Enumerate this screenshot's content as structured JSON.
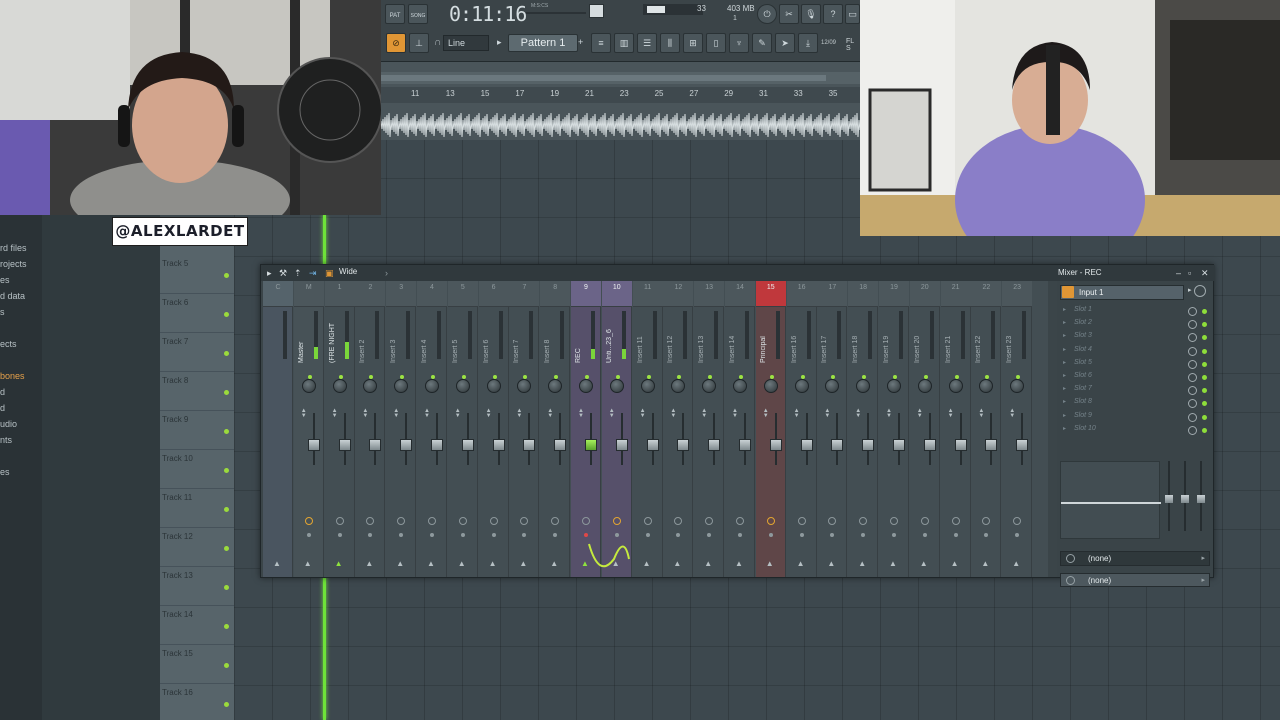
{
  "overlay": {
    "handle": "@ALEXLARDET"
  },
  "toolbar": {
    "mode_pat": "PAT",
    "mode_song": "SONG",
    "time": "0:11:16",
    "time_unit": "M:S:CS",
    "cpu": "33",
    "memory": "403 MB",
    "memory_sub": "1",
    "snap": "Line",
    "pattern": "Pattern 1",
    "time_sig": "12/09",
    "fl_label": "FL S"
  },
  "timeline": {
    "ruler": [
      "11",
      "13",
      "15",
      "17",
      "19",
      "21",
      "23",
      "25",
      "27",
      "29",
      "31",
      "33",
      "35"
    ]
  },
  "browser": {
    "items": [
      {
        "label": "rd files",
        "highlight": false
      },
      {
        "label": "rojects",
        "highlight": false
      },
      {
        "label": "es",
        "highlight": false
      },
      {
        "label": "d data",
        "highlight": false
      },
      {
        "label": "s",
        "highlight": false
      },
      {
        "label": "ects",
        "highlight": false
      },
      {
        "label": "bones",
        "highlight": true
      },
      {
        "label": "d",
        "highlight": false
      },
      {
        "label": "d",
        "highlight": false
      },
      {
        "label": "udio",
        "highlight": false
      },
      {
        "label": "nts",
        "highlight": false
      },
      {
        "label": "es",
        "highlight": false
      }
    ]
  },
  "playlist": {
    "tracks": [
      "Track 5",
      "Track 6",
      "Track 7",
      "Track 8",
      "Track 9",
      "Track 10",
      "Track 11",
      "Track 12",
      "Track 13",
      "Track 14",
      "Track 15",
      "Track 16"
    ]
  },
  "mixer": {
    "title": "Mixer - REC",
    "preset": "Wide",
    "strips": [
      {
        "num": "C",
        "name": "",
        "kind": "current"
      },
      {
        "num": "M",
        "name": "Master",
        "kind": "master"
      },
      {
        "num": "1",
        "name": "(FRE NIGHT",
        "kind": "bright"
      },
      {
        "num": "2",
        "name": "Insert 2",
        "kind": "normal"
      },
      {
        "num": "3",
        "name": "Insert 3",
        "kind": "normal"
      },
      {
        "num": "4",
        "name": "Insert 4",
        "kind": "normal"
      },
      {
        "num": "5",
        "name": "Insert 5",
        "kind": "normal"
      },
      {
        "num": "6",
        "name": "Insert 6",
        "kind": "normal"
      },
      {
        "num": "7",
        "name": "Insert 7",
        "kind": "normal"
      },
      {
        "num": "8",
        "name": "Insert 8",
        "kind": "normal"
      },
      {
        "num": "9",
        "name": "REC",
        "kind": "purple"
      },
      {
        "num": "10",
        "name": "Unti...23_6",
        "kind": "purple"
      },
      {
        "num": "11",
        "name": "Insert 11",
        "kind": "normal"
      },
      {
        "num": "12",
        "name": "Insert 12",
        "kind": "normal"
      },
      {
        "num": "13",
        "name": "Insert 13",
        "kind": "normal"
      },
      {
        "num": "14",
        "name": "Insert 14",
        "kind": "normal"
      },
      {
        "num": "15",
        "name": "Principal",
        "kind": "red"
      },
      {
        "num": "16",
        "name": "Insert 16",
        "kind": "normal"
      },
      {
        "num": "17",
        "name": "Insert 17",
        "kind": "normal"
      },
      {
        "num": "18",
        "name": "Insert 18",
        "kind": "normal"
      },
      {
        "num": "19",
        "name": "Insert 19",
        "kind": "normal"
      },
      {
        "num": "20",
        "name": "Insert 20",
        "kind": "normal"
      },
      {
        "num": "21",
        "name": "Insert 21",
        "kind": "normal"
      },
      {
        "num": "22",
        "name": "Insert 22",
        "kind": "normal"
      },
      {
        "num": "23",
        "name": "Insert 23",
        "kind": "normal"
      }
    ],
    "input": "Input 1",
    "slots": [
      "Slot 1",
      "Slot 2",
      "Slot 3",
      "Slot 4",
      "Slot 5",
      "Slot 6",
      "Slot 7",
      "Slot 8",
      "Slot 9",
      "Slot 10"
    ],
    "output_1": "(none)",
    "output_2": "(none)"
  },
  "colors": {
    "playhead": "#6ee339",
    "accent_red": "#c0383c",
    "accent_purple": "#6b6488",
    "led_green": "#8ede3a",
    "orange": "#e09635"
  }
}
